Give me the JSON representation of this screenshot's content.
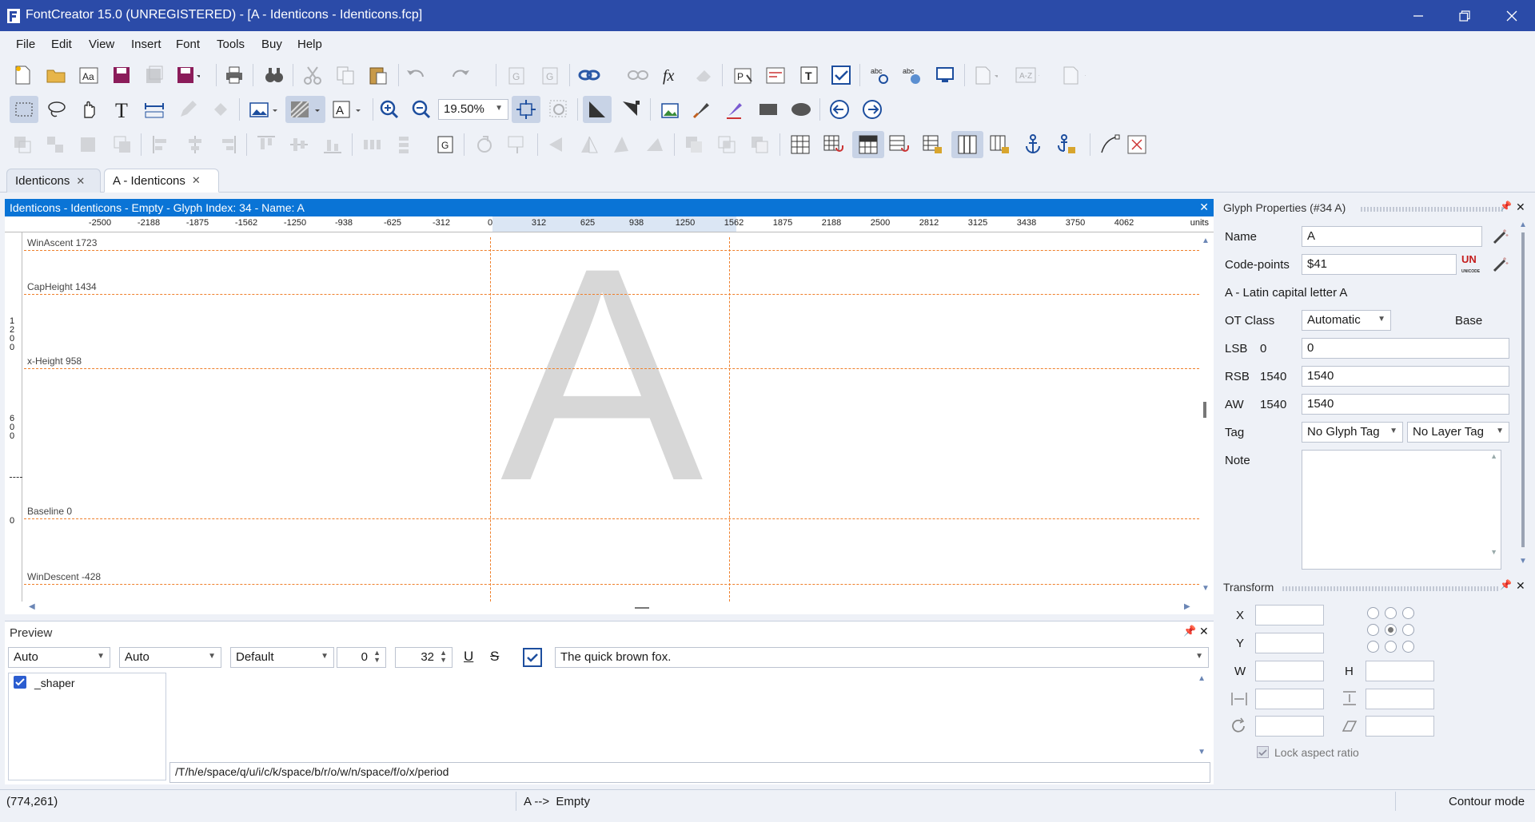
{
  "window": {
    "title": "FontCreator 15.0 (UNREGISTERED) - [A - Identicons - Identicons.fcp]",
    "controls": [
      "minimize-icon",
      "restore-icon",
      "close-icon"
    ]
  },
  "menu": [
    "File",
    "Edit",
    "View",
    "Insert",
    "Font",
    "Tools",
    "Buy",
    "Help"
  ],
  "toolbar": {
    "zoom_value": "19.50%"
  },
  "tabs": [
    {
      "label": "Identicons",
      "active": false
    },
    {
      "label": "A - Identicons",
      "active": true
    }
  ],
  "editor": {
    "title": "Identicons - Identicons - Empty - Glyph Index: 34 - Name: A",
    "ruler_ticks": [
      "-2500",
      "-2188",
      "-1875",
      "-1562",
      "-1250",
      "-938",
      "-625",
      "-312",
      "0",
      "312",
      "625",
      "938",
      "1250",
      "1562",
      "1875",
      "2188",
      "2500",
      "2812",
      "3125",
      "3438",
      "3750",
      "4062"
    ],
    "ruler_unit": "units",
    "vruler_labels": [
      "1200",
      "600",
      "0"
    ],
    "metrics": [
      {
        "label": "WinAscent 1723"
      },
      {
        "label": "CapHeight 1434"
      },
      {
        "label": "x-Height 958"
      },
      {
        "label": "Baseline 0"
      },
      {
        "label": "WinDescent -428"
      }
    ],
    "glyph_char": "A"
  },
  "preview": {
    "title": "Preview",
    "script_combo": "Auto",
    "language_combo": "Auto",
    "features_combo": "Default",
    "spacing_value": "0",
    "size_value": "32",
    "sample_text": "The quick brown fox.",
    "shaper_label": "_shaper",
    "glyph_string": "/T/h/e/space/q/u/i/c/k/space/b/r/o/w/n/space/f/o/x/period"
  },
  "glyph_properties": {
    "title": "Glyph Properties (#34 A)",
    "name_label": "Name",
    "name_value": "A",
    "codepoints_label": "Code-points",
    "codepoints_value": "$41",
    "description": "A - Latin capital letter A",
    "otclass_label": "OT Class",
    "otclass_value": "Automatic",
    "otclass_extra": "Base",
    "lsb_label": "LSB",
    "lsb_current": "0",
    "lsb_value": "0",
    "rsb_label": "RSB",
    "rsb_current": "1540",
    "rsb_value": "1540",
    "aw_label": "AW",
    "aw_current": "1540",
    "aw_value": "1540",
    "tag_label": "Tag",
    "glyph_tag": "No Glyph Tag",
    "layer_tag": "No Layer Tag",
    "note_label": "Note",
    "unicode_logo_text": "UNICODE"
  },
  "transform": {
    "title": "Transform",
    "x_label": "X",
    "y_label": "Y",
    "w_label": "W",
    "h_label": "H",
    "lock_label": "Lock aspect ratio"
  },
  "status": {
    "coords": "(774,261)",
    "glyph_info": "A -->  Empty",
    "mode": "Contour mode"
  },
  "colors": {
    "titlebar": "#2b4ba8",
    "editor_title": "#0a74d6",
    "guide": "#ef7f2a"
  }
}
